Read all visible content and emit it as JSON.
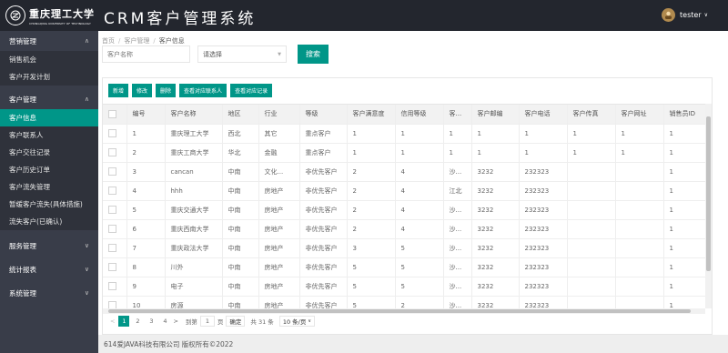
{
  "header": {
    "logo_cn": "重庆理工大学",
    "logo_en": "CHONGQING UNIVERSITY OF TECHNOLOGY",
    "app_title": "CRM客户管理系统",
    "username": "tester",
    "caret": "∨"
  },
  "sidebar": {
    "groups": [
      {
        "label": "营销管理",
        "chevron": "∧",
        "items": [
          "销售机会",
          "客户开发计划"
        ]
      },
      {
        "label": "客户管理",
        "chevron": "∧",
        "items": [
          "客户信息",
          "客户联系人",
          "客户交往记录",
          "客户历史订单",
          "客户流失管理",
          "暂缓客户流失(具体措施)",
          "流失客户(已确认)"
        ]
      },
      {
        "label": "服务管理",
        "chevron": "∨"
      },
      {
        "label": "统计报表",
        "chevron": "∨"
      },
      {
        "label": "系统管理",
        "chevron": "∨"
      }
    ]
  },
  "breadcrumb": {
    "items": [
      "首页",
      "客户管理",
      "客户信息"
    ],
    "sep": "/"
  },
  "search": {
    "name_placeholder": "客户名称",
    "select_value": "请选择",
    "button": "搜索"
  },
  "toolbar": [
    "新增",
    "修改",
    "删除",
    "查看对应联系人",
    "查看对应记录"
  ],
  "table": {
    "headers": [
      "编号",
      "客户名称",
      "地区",
      "行业",
      "等级",
      "客户满意度",
      "信用等级",
      "客...",
      "客户邮编",
      "客户电话",
      "客户传真",
      "客户网址",
      "销售员ID"
    ],
    "rows": [
      [
        "1",
        "重庆理工大学",
        "西北",
        "其它",
        "重点客户",
        "1",
        "1",
        "1",
        "1",
        "1",
        "1",
        "1",
        "1"
      ],
      [
        "2",
        "重庆工商大学",
        "华北",
        "金融",
        "重点客户",
        "1",
        "1",
        "1",
        "1",
        "1",
        "1",
        "1",
        "1"
      ],
      [
        "3",
        "cancan",
        "中南",
        "文化...",
        "非优先客户",
        "2",
        "4",
        "沙...",
        "3232",
        "232323",
        "",
        "",
        "1"
      ],
      [
        "4",
        "hhh",
        "中南",
        "房地产",
        "非优先客户",
        "2",
        "4",
        "江北",
        "3232",
        "232323",
        "",
        "",
        "1"
      ],
      [
        "5",
        "重庆交通大学",
        "中南",
        "房地产",
        "非优先客户",
        "2",
        "4",
        "沙...",
        "3232",
        "232323",
        "",
        "",
        "1"
      ],
      [
        "6",
        "重庆西南大学",
        "中南",
        "房地产",
        "非优先客户",
        "2",
        "4",
        "沙...",
        "3232",
        "232323",
        "",
        "",
        "1"
      ],
      [
        "7",
        "重庆政法大学",
        "中南",
        "房地产",
        "非优先客户",
        "3",
        "5",
        "沙...",
        "3232",
        "232323",
        "",
        "",
        "1"
      ],
      [
        "8",
        "川外",
        "中南",
        "房地产",
        "非优先客户",
        "5",
        "5",
        "沙...",
        "3232",
        "232323",
        "",
        "",
        "1"
      ],
      [
        "9",
        "电子",
        "中南",
        "房地产",
        "非优先客户",
        "5",
        "5",
        "沙...",
        "3232",
        "232323",
        "",
        "",
        "1"
      ],
      [
        "10",
        "房源",
        "中南",
        "房地产",
        "非优先客户",
        "5",
        "2",
        "沙...",
        "3232",
        "232323",
        "",
        "",
        "1"
      ]
    ]
  },
  "pager": {
    "prev": "<",
    "pages": [
      "1",
      "2",
      "3",
      "4"
    ],
    "next": ">",
    "goto_label": "到第",
    "goto_value": "1",
    "page_unit": "页",
    "confirm": "确定",
    "total": "共 31 条",
    "page_size": "10 条/页",
    "size_caret": "∨"
  },
  "footer": "614爱JAVA科技有限公司 版权所有©2022",
  "colors": {
    "accent": "#009688",
    "header_bg": "#23262e",
    "sidebar_bg": "#393d49"
  }
}
